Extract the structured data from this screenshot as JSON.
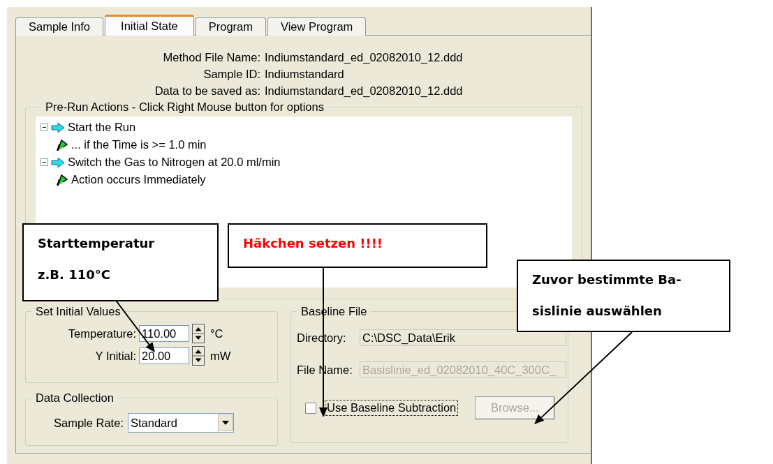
{
  "tabs": [
    {
      "label": "Sample Info",
      "selected": false
    },
    {
      "label": "Initial State",
      "selected": true
    },
    {
      "label": "Program",
      "selected": false
    },
    {
      "label": "View Program",
      "selected": false
    }
  ],
  "info": [
    {
      "label": "Method File Name:",
      "value": "Indiumstandard_ed_02082010_12.ddd"
    },
    {
      "label": "Sample ID:",
      "value": "Indiumstandard"
    },
    {
      "label": "Data to be saved as:",
      "value": "Indiumstandard_ed_02082010_12.ddd"
    }
  ],
  "pre_run_actions": {
    "title": "Pre-Run Actions - Click Right Mouse button for options",
    "tree": [
      {
        "label": "Start the Run",
        "kind": "action",
        "expanded": true,
        "children": [
          {
            "label": "... if the Time is >= 1.0 min",
            "kind": "condition"
          }
        ]
      },
      {
        "label": "Switch the Gas to Nitrogen at 20.0 ml/min",
        "kind": "action",
        "expanded": true,
        "children": [
          {
            "label": "Action occurs Immediately",
            "kind": "condition"
          }
        ]
      }
    ]
  },
  "set_initial_values": {
    "title": "Set Initial Values",
    "fields": [
      {
        "label": "Temperature:",
        "value": "110.00",
        "unit": "°C"
      },
      {
        "label": "Y Initial:",
        "value": "20.00",
        "unit": "mW"
      }
    ]
  },
  "data_collection": {
    "title": "Data Collection",
    "label": "Sample Rate:",
    "value": "Standard"
  },
  "baseline_file": {
    "title": "Baseline File",
    "fields": [
      {
        "label": "Directory:",
        "value": "C:\\DSC_Data\\Erik",
        "disabled": true
      },
      {
        "label": "File Name:",
        "value": "Basislinie_ed_02082010_40C_300C_",
        "disabled": true
      }
    ],
    "checkbox": {
      "label": "Use Baseline Subtraction",
      "checked": false,
      "focused": true
    },
    "browse": {
      "label": "Browse...",
      "disabled": true
    }
  },
  "callouts": [
    {
      "lines": [
        "Starttemperatur",
        "z.B. 110°C"
      ],
      "color": "#000000"
    },
    {
      "lines": [
        "Häkchen setzen !!!!"
      ],
      "color": "#ff0000"
    },
    {
      "lines": [
        "Zuvor bestimmte Ba-",
        "sislinie auswählen"
      ],
      "color": "#000000"
    }
  ]
}
